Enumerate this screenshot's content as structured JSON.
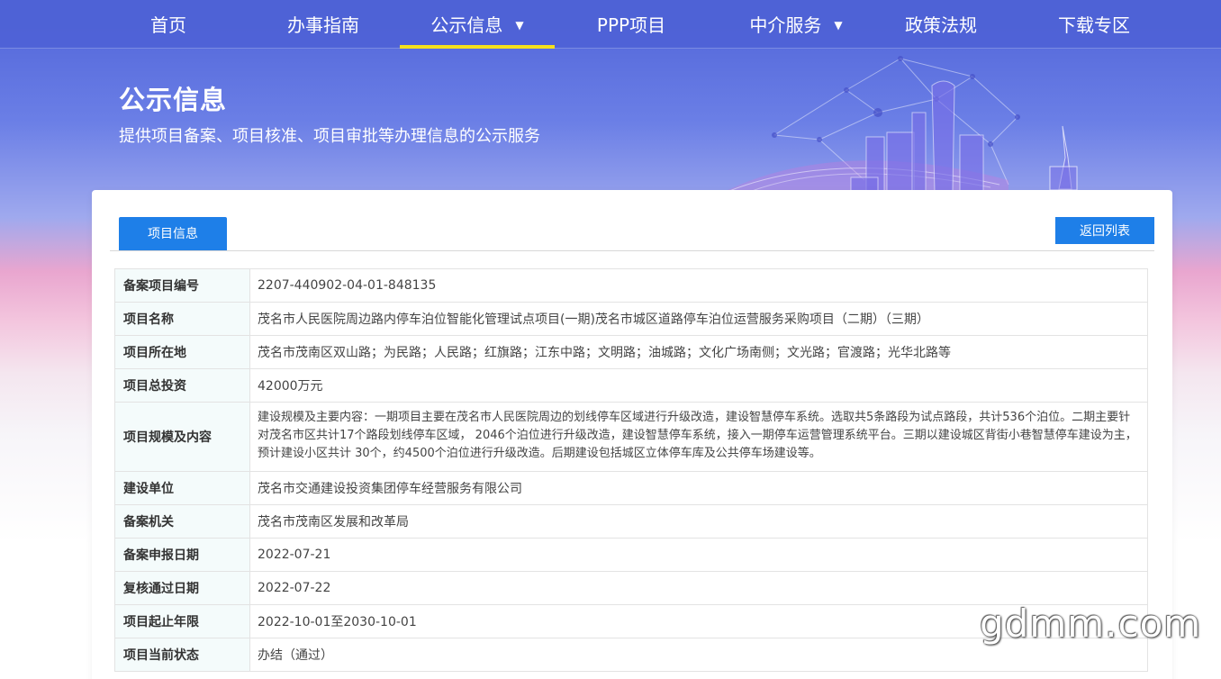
{
  "nav": {
    "items": [
      {
        "label": "首页",
        "dropdown": false,
        "active": false
      },
      {
        "label": "办事指南",
        "dropdown": false,
        "active": false
      },
      {
        "label": "公示信息",
        "dropdown": true,
        "active": true
      },
      {
        "label": "PPP项目",
        "dropdown": false,
        "active": false
      },
      {
        "label": "中介服务",
        "dropdown": true,
        "active": false
      },
      {
        "label": "政策法规",
        "dropdown": false,
        "active": false
      },
      {
        "label": "下载专区",
        "dropdown": false,
        "active": false
      }
    ],
    "caret": "▼"
  },
  "hero": {
    "title": "公示信息",
    "subtitle": "提供项目备案、项目核准、项目审批等办理信息的公示服务"
  },
  "card": {
    "tab_label": "项目信息",
    "back_button": "返回列表"
  },
  "details": [
    {
      "key": "备案项目编号",
      "value": "2207-440902-04-01-848135"
    },
    {
      "key": "项目名称",
      "value": "茂名市人民医院周边路内停车泊位智能化管理试点项目(一期)茂名市城区道路停车泊位运营服务采购项目（二期）（三期）"
    },
    {
      "key": "项目所在地",
      "value": "茂名市茂南区双山路；为民路；人民路；红旗路；江东中路；文明路；油城路；文化广场南侧；文光路；官渡路；光华北路等"
    },
    {
      "key": "项目总投资",
      "value": "42000万元"
    },
    {
      "key": "项目规模及内容",
      "value": "建设规模及主要内容：一期项目主要在茂名市人民医院周边的划线停车区域进行升级改造，建设智慧停车系统。选取共5条路段为试点路段，共计536个泊位。二期主要针对茂名市区共计17个路段划线停车区域， 2046个泊位进行升级改造，建设智慧停车系统，接入一期停车运营管理系统平台。三期以建设城区背街小巷智慧停车建设为主，预计建设小区共计 30个，约4500个泊位进行升级改造。后期建设包括城区立体停车库及公共停车场建设等。"
    },
    {
      "key": "建设单位",
      "value": "茂名市交通建设投资集团停车经营服务有限公司"
    },
    {
      "key": "备案机关",
      "value": "茂名市茂南区发展和改革局"
    },
    {
      "key": "备案申报日期",
      "value": "2022-07-21"
    },
    {
      "key": "复核通过日期",
      "value": "2022-07-22"
    },
    {
      "key": "项目起止年限",
      "value": "2022-10-01至2030-10-01"
    },
    {
      "key": "项目当前状态",
      "value": "办结（通过）"
    }
  ],
  "watermark": "gdmm.com",
  "colors": {
    "nav_bg": "#4e62d6",
    "active_underline": "#f5e11b",
    "primary_button": "#1e7fe8",
    "label_cell_bg": "#f4fbfb"
  }
}
